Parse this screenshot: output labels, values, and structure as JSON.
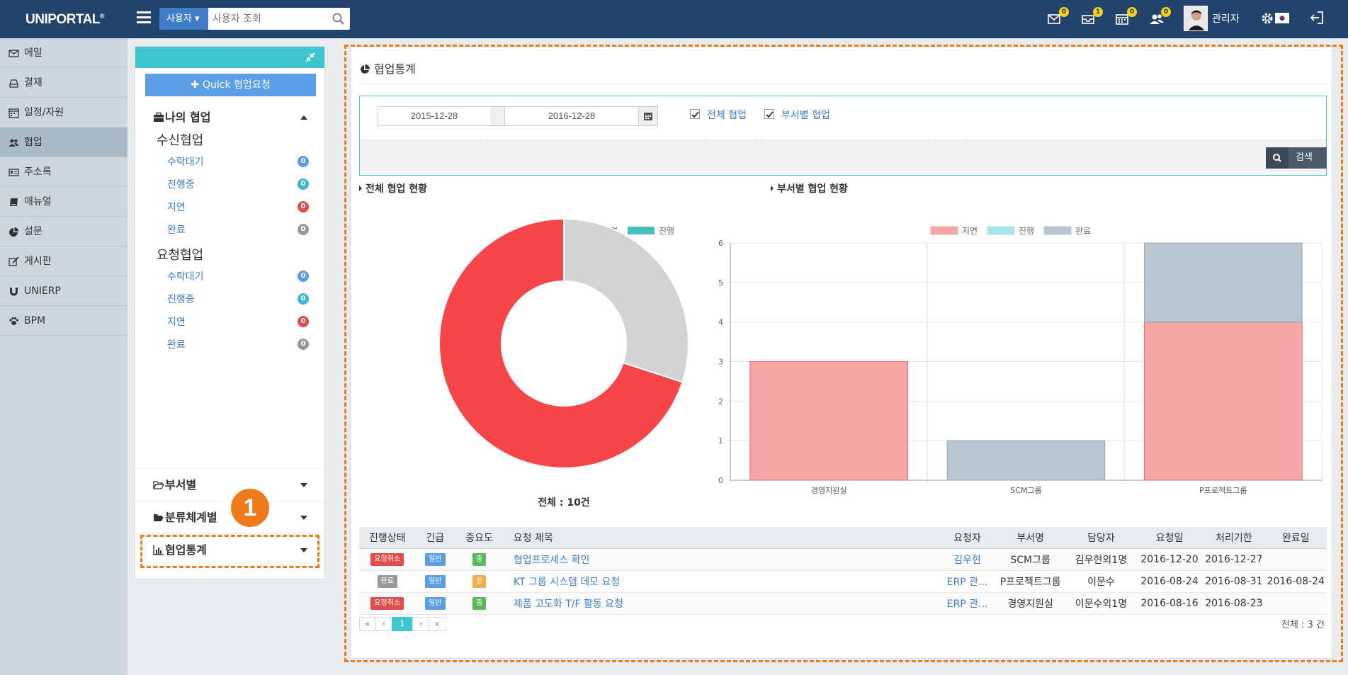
{
  "topbar": {
    "logo": "UNIPORTAL",
    "logo_mark": "®",
    "search_scope": "사용자",
    "search_placeholder": "사용자 조회",
    "icons": [
      {
        "name": "mail-icon",
        "badge": "0"
      },
      {
        "name": "inbox-icon",
        "badge": "1"
      },
      {
        "name": "calendar-icon",
        "badge": "0"
      },
      {
        "name": "users-icon",
        "badge": "0"
      }
    ],
    "user_name": "관리자"
  },
  "sidebar": {
    "items": [
      {
        "label": "메일",
        "icon": "mail-icon"
      },
      {
        "label": "결재",
        "icon": "inbox-icon"
      },
      {
        "label": "일정/자원",
        "icon": "calendar-icon"
      },
      {
        "label": "협업",
        "icon": "users-icon",
        "active": true
      },
      {
        "label": "주소록",
        "icon": "addressbook-icon"
      },
      {
        "label": "매뉴얼",
        "icon": "book-icon"
      },
      {
        "label": "설문",
        "icon": "piechart-icon"
      },
      {
        "label": "게시판",
        "icon": "edit-icon"
      },
      {
        "label": "UNIERP",
        "icon": "magnet-icon"
      },
      {
        "label": "BPM",
        "icon": "paw-icon"
      }
    ]
  },
  "mid": {
    "quick_button": "Quick 협업요청",
    "my_collab": "나의 협업",
    "received_title": "수신협업",
    "received": [
      {
        "label": "수락대기",
        "count": "0",
        "color": "#5b9ee6"
      },
      {
        "label": "진행중",
        "count": "0",
        "color": "#3fb8cf"
      },
      {
        "label": "지연",
        "count": "0",
        "color": "#e24c4c"
      },
      {
        "label": "완료",
        "count": "0",
        "color": "#999999"
      }
    ],
    "requested_title": "요청협업",
    "requested": [
      {
        "label": "수락대기",
        "count": "0",
        "color": "#5b9ee6"
      },
      {
        "label": "진행중",
        "count": "0",
        "color": "#3fb8cf"
      },
      {
        "label": "지연",
        "count": "0",
        "color": "#e24c4c"
      },
      {
        "label": "완료",
        "count": "0",
        "color": "#999999"
      }
    ],
    "by_dept": "부서별",
    "by_category": "분류체계별",
    "stats": "협업통계"
  },
  "content": {
    "title": "협업통계",
    "date_from": "2015-12-28",
    "date_to": "2016-12-28",
    "check_all": "전체 협업",
    "check_dept": "부서별 협업",
    "search_button": "검색",
    "overall_title": "전체 협업 현황",
    "dept_title": "부서별 협업 현황",
    "total_label": "전체 : 10건",
    "table": {
      "headers": [
        "진행상태",
        "긴급",
        "중요도",
        "요청 제목",
        "요청자",
        "부서명",
        "담당자",
        "요청일",
        "처리기한",
        "완료일"
      ],
      "rows": [
        {
          "status": "요청취소",
          "status_color": "#e24c4c",
          "urgency": "일반",
          "importance": "중",
          "imp_color": "#5cb85c",
          "title": "협업프로세스 확인",
          "requester": "김우현",
          "dept": "SCM그룹",
          "owner": "김우현외1명",
          "req_date": "2016-12-20",
          "due": "2016-12-27",
          "done": ""
        },
        {
          "status": "완료",
          "status_color": "#999999",
          "urgency": "일반",
          "importance": "상",
          "imp_color": "#f0ad4e",
          "title": "KT 그룹 시스템 데모 요청",
          "requester": "ERP 관...",
          "dept": "P프로젝트그룹",
          "owner": "이문수",
          "req_date": "2016-08-24",
          "due": "2016-08-31",
          "done": "2016-08-24"
        },
        {
          "status": "요청취소",
          "status_color": "#e24c4c",
          "urgency": "일반",
          "importance": "중",
          "imp_color": "#5cb85c",
          "title": "제품 고도화 T/F 활동 요청",
          "requester": "ERP 관...",
          "dept": "경영지원실",
          "owner": "이문수외1명",
          "req_date": "2016-08-16",
          "due": "2016-08-23",
          "done": ""
        }
      ]
    },
    "pager": [
      "«",
      "‹",
      "1",
      "›",
      "»"
    ],
    "total_rows": "전체 : 3 건"
  },
  "callout": "1",
  "chart_data": [
    {
      "type": "pie",
      "legend": [
        "완료",
        "지연",
        "진행"
      ],
      "colors": [
        "#d3d3d3",
        "#f7464a",
        "#46bfbd"
      ],
      "values": [
        3,
        7,
        0
      ],
      "donut": true
    },
    {
      "type": "bar",
      "stacked": true,
      "categories": [
        "경영지원실",
        "SCM그룹",
        "P프로젝트그룹"
      ],
      "series": [
        {
          "name": "지연",
          "values": [
            3,
            0,
            4
          ],
          "color": "#f5a6a6"
        },
        {
          "name": "진행",
          "values": [
            0,
            0,
            0
          ],
          "color": "#a6e3ea"
        },
        {
          "name": "완료",
          "values": [
            0,
            1,
            2
          ],
          "color": "#b8c6d1"
        }
      ],
      "ylim": [
        0,
        6
      ],
      "yticks": [
        0,
        1,
        2,
        3,
        4,
        5,
        6
      ],
      "legend": "top"
    }
  ]
}
